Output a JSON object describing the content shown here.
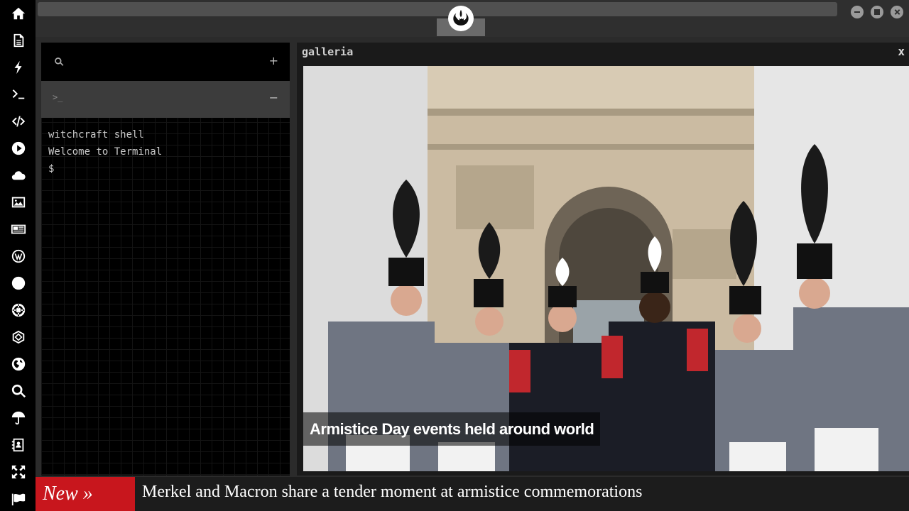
{
  "sidebar": {
    "items": [
      {
        "icon": "home-icon"
      },
      {
        "icon": "document-icon"
      },
      {
        "icon": "bolt-icon"
      },
      {
        "icon": "terminal-icon"
      },
      {
        "icon": "code-icon"
      },
      {
        "icon": "play-icon"
      },
      {
        "icon": "cloud-icon"
      },
      {
        "icon": "image-icon"
      },
      {
        "icon": "newspaper-icon"
      },
      {
        "icon": "wordpress-icon"
      },
      {
        "icon": "pinterest-icon"
      },
      {
        "icon": "galactic-empire-icon"
      },
      {
        "icon": "network-sphere-icon"
      },
      {
        "icon": "globe-icon"
      },
      {
        "icon": "search-icon"
      },
      {
        "icon": "umbrella-icon"
      },
      {
        "icon": "address-book-icon"
      },
      {
        "icon": "expand-icon"
      },
      {
        "icon": "flag-icon"
      }
    ]
  },
  "topbar": {
    "logo_icon": "rebel-alliance-icon",
    "window_controls": [
      "minimize-icon",
      "maximize-icon",
      "close-icon"
    ]
  },
  "terminal": {
    "search_icon": "search-icon",
    "add_label": "+",
    "tab_prompt": ">_",
    "collapse_label": "−",
    "lines": [
      "witchcraft shell",
      "Welcome to Terminal",
      "$"
    ]
  },
  "galleria": {
    "title": "galleria",
    "close_label": "x",
    "caption": "Armistice Day events held around world"
  },
  "ticker": {
    "badge": "New »",
    "headline": "Merkel and Macron share a tender moment at armistice commemorations"
  },
  "colors": {
    "accent": "#c8161d",
    "background": "#2b2b2b",
    "panel": "#000000"
  }
}
